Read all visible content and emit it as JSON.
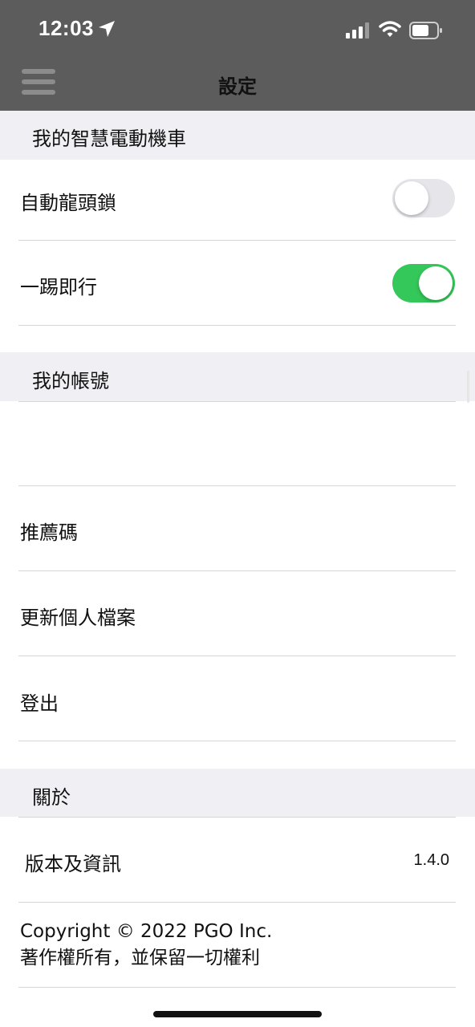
{
  "status_bar": {
    "time": "12:03",
    "icons": [
      "location-arrow-icon",
      "signal-icon",
      "wifi-icon",
      "battery-icon"
    ]
  },
  "nav": {
    "title": "設定",
    "menu_icon": "hamburger-menu-icon"
  },
  "sections": {
    "scooter": {
      "header": "我的智慧電動機車",
      "items": [
        {
          "label": "自動龍頭鎖",
          "toggle": "off"
        },
        {
          "label": "一踢即行",
          "toggle": "on"
        }
      ]
    },
    "account": {
      "header": "我的帳號",
      "items": [
        {
          "label": ""
        },
        {
          "label": "推薦碼"
        },
        {
          "label": "更新個人檔案"
        },
        {
          "label": "登出"
        }
      ]
    },
    "about": {
      "header": "關於",
      "version_label": "版本及資訊",
      "version_value": "1.4.0",
      "copyright_line1": "Copyright © 2022 PGO Inc.",
      "copyright_line2": "著作權所有，並保留一切權利"
    }
  },
  "colors": {
    "header_bg": "#5c5c5c",
    "section_bg": "#efeff4",
    "toggle_on": "#34c759",
    "toggle_off": "#e5e5ea"
  }
}
